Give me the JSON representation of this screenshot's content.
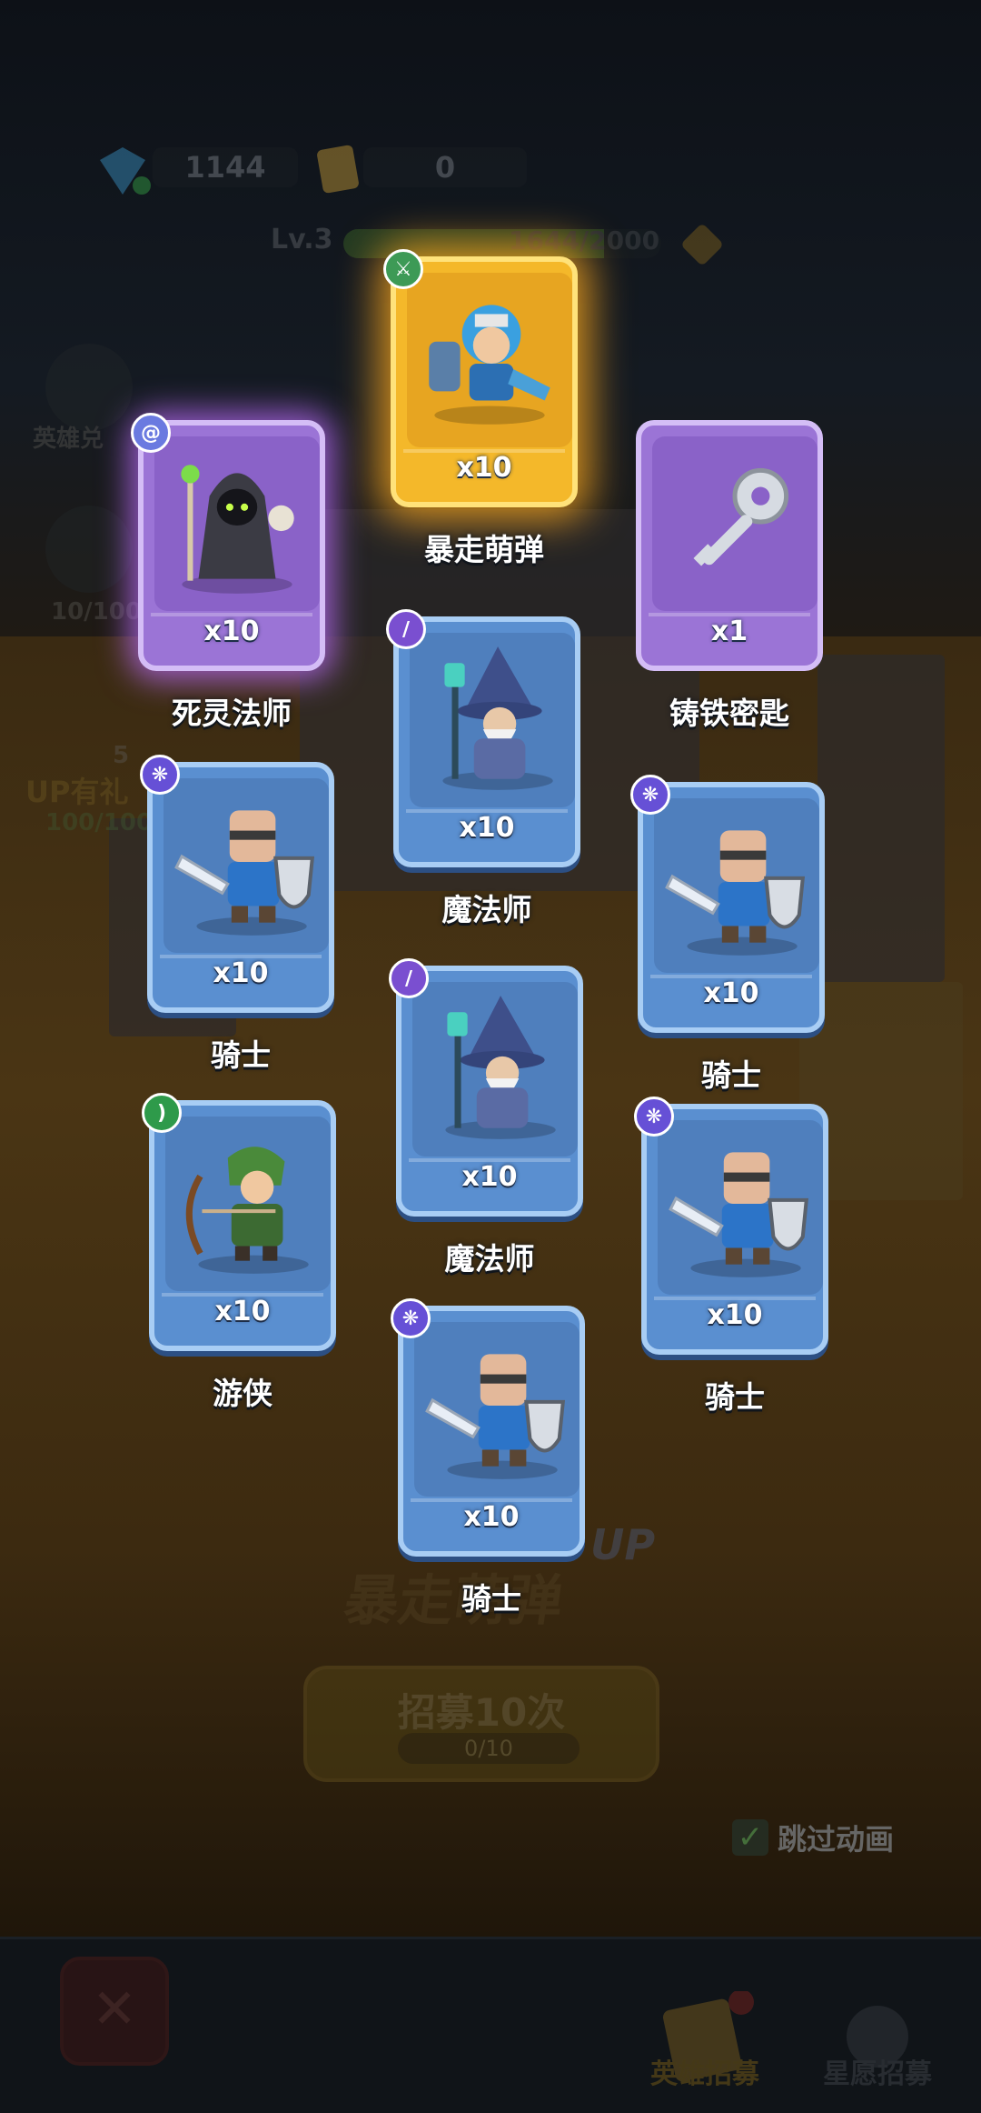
{
  "hud": {
    "gems": "1144",
    "tickets": "0",
    "level": "Lv.3",
    "level_progress_text": "1644/2000",
    "level_progress": 0.82
  },
  "left_menu": {
    "hero_exchange": "英雄兑",
    "item_count": "10/100",
    "up_gift": "UP有礼",
    "up_gift_count": "5",
    "up_gift_progress": "100/100"
  },
  "banner": {
    "hero_name": "暴走萌弹",
    "up": "UP"
  },
  "recruit": {
    "label": "招募10次",
    "progress": "0/10"
  },
  "skip_animation": "跳过动画",
  "tabs": {
    "hero_recruit": "英雄招募",
    "star_recruit": "星愿招募"
  },
  "cards": [
    {
      "name": "暴走萌弹",
      "qty": "x10",
      "rarity": "gold",
      "badge": "sword-icon",
      "art": "hero-bomber"
    },
    {
      "name": "死灵法师",
      "qty": "x10",
      "rarity": "purple",
      "badge": "swirl-icon",
      "art": "necromancer"
    },
    {
      "name": "铸铁密匙",
      "qty": "x1",
      "rarity": "purple",
      "badge": "",
      "art": "iron-key"
    },
    {
      "name": "魔法师",
      "qty": "x10",
      "rarity": "blue",
      "badge": "staff-icon",
      "art": "wizard"
    },
    {
      "name": "骑士",
      "qty": "x10",
      "rarity": "blue",
      "badge": "paw-icon",
      "art": "knight"
    },
    {
      "name": "骑士",
      "qty": "x10",
      "rarity": "blue",
      "badge": "paw-icon",
      "art": "knight"
    },
    {
      "name": "魔法师",
      "qty": "x10",
      "rarity": "blue",
      "badge": "staff-icon",
      "art": "wizard"
    },
    {
      "name": "游侠",
      "qty": "x10",
      "rarity": "blue",
      "badge": "bow-icon",
      "art": "ranger"
    },
    {
      "name": "骑士",
      "qty": "x10",
      "rarity": "blue",
      "badge": "paw-icon",
      "art": "knight"
    },
    {
      "name": "骑士",
      "qty": "x10",
      "rarity": "blue",
      "badge": "paw-icon",
      "art": "knight"
    }
  ],
  "colors": {
    "gold": "#f4b82a",
    "purple": "#9b74d6",
    "blue": "#5a8fd0",
    "background": "#0c1016"
  }
}
